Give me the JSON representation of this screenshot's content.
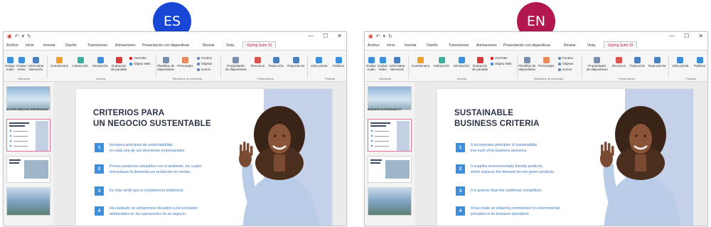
{
  "badges": {
    "es": "ES",
    "en": "EN"
  },
  "windows": {
    "es": {
      "tabs": [
        "Archivo",
        "Inicio",
        "Insertar",
        "Diseño",
        "Transiciones",
        "Animaciones",
        "Presentación con diapositivas",
        "Revisar",
        "Vista",
        "iSpring Suite 10"
      ],
      "ribbon": {
        "record_audio": [
          "Grabar",
          "Audio"
        ],
        "record_video": [
          "Grabar",
          "Video"
        ],
        "manage_narration": [
          "Administrar",
          "Narración"
        ],
        "group_narration": "Narración",
        "quiz": "Cuestionario",
        "interaction": "Interacción",
        "simulation": "Simulación",
        "screen_record": [
          "Grabación",
          "de pantalla"
        ],
        "youtube": "YouTube",
        "web_object": "Objeto Web",
        "group_insert": "Insertar",
        "templates": [
          "Plantillas de",
          "diapositivas"
        ],
        "characters": "Personajes",
        "backgrounds": "Fondos",
        "objects": "Objetos",
        "icons": "Iconos",
        "group_library": "Biblioteca de contenido",
        "slide_props": [
          "Propiedades",
          "de diapositivas"
        ],
        "resources": "Recursos",
        "translation": "Traducción",
        "player": "Reproductor",
        "group_presentation": "Presentación",
        "preview": "Vista previa",
        "publish": "Publicar",
        "group_publish": "Publicar"
      },
      "thumb_caption": "SUSTENTABILIDAD EMPRESARIAL",
      "slide": {
        "title": [
          "CRITERIOS PARA",
          "UN NEGOCIO SUSTENTABLE"
        ],
        "items": [
          {
            "n": "1",
            "lines": [
              "Incorpora principios de sustentabilidad",
              "en cada una de sus decisiones empresariales."
            ]
          },
          {
            "n": "2",
            "lines": [
              "Provee productos amigables con el ambiente, los cuales",
              "reemplazan la demanda por productos no-verdes."
            ]
          },
          {
            "n": "3",
            "lines": [
              "Es más verde que la competencia tradicional."
            ]
          },
          {
            "n": "4",
            "lines": [
              "Ha realizado un compromiso duradero a los principios",
              "ambientales en las operaciones de su negocio."
            ]
          }
        ]
      }
    },
    "en": {
      "tabs": [
        "Archivo",
        "Inicio",
        "Insertar",
        "Diseño",
        "Transiciones",
        "Animaciones",
        "Presentación con diapositivas",
        "Revisar",
        "Vista",
        "iSpring Suite 10"
      ],
      "ribbon": {
        "record_audio": [
          "Grabar",
          "Audio"
        ],
        "record_video": [
          "Grabar",
          "Video"
        ],
        "manage_narration": [
          "Administrar",
          "Narración"
        ],
        "group_narration": "Narración",
        "quiz": "Cuestionario",
        "interaction": "Interacción",
        "simulation": "Simulación",
        "screen_record": [
          "Grabación",
          "de pantalla"
        ],
        "youtube": "YouTube",
        "web_object": "Objeto Web",
        "group_insert": "Insertar",
        "templates": [
          "Plantillas de",
          "diapositivas"
        ],
        "characters": "Personajes",
        "backgrounds": "Fondos",
        "objects": "Objetos",
        "icons": "Iconos",
        "group_library": "Biblioteca de contenido",
        "slide_props": [
          "Propiedades",
          "de diapositivas"
        ],
        "resources": "Recursos",
        "translation": "Traducción",
        "player": "Reproductor",
        "group_presentation": "Presentación",
        "preview": "Vista previa",
        "publish": "Publicar",
        "group_publish": "Publicar"
      },
      "thumb_caption": "BUSINESS SUSTAINABILITY",
      "slide": {
        "title": [
          "SUSTAINABLE",
          "BUSINESS CRITERIA"
        ],
        "items": [
          {
            "n": "1",
            "lines": [
              "It incorporates principles of sustainability",
              "into each of its business decisions."
            ]
          },
          {
            "n": "2",
            "lines": [
              "It supplies environmentally friendly products,",
              "which replaces the demand for non-green products."
            ]
          },
          {
            "n": "3",
            "lines": [
              "It is greener than the traditional competition."
            ]
          },
          {
            "n": "4",
            "lines": [
              "It has made an enduring commitment to environmental",
              "principles in its business operations."
            ]
          }
        ]
      }
    }
  }
}
